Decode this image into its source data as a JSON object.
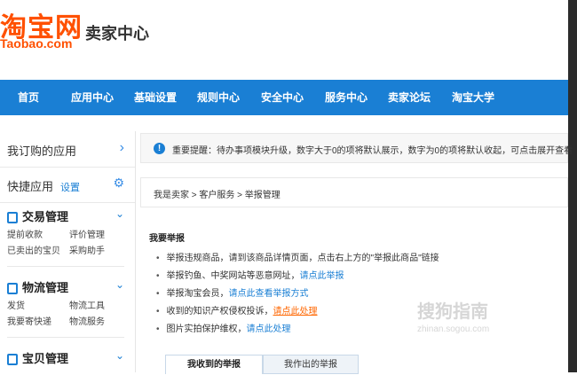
{
  "header": {
    "logo_cn": "淘宝网",
    "logo_en": "Taobao.com",
    "center_title": "卖家中心"
  },
  "nav": [
    "首页",
    "应用中心",
    "基础设置",
    "规则中心",
    "安全中心",
    "服务中心",
    "卖家论坛",
    "淘宝大学"
  ],
  "sidebar": {
    "my_apps": "我订购的应用",
    "quick_apps": "快捷应用",
    "quick_apps_setting": "设置",
    "groups": [
      {
        "title": "交易管理",
        "links": [
          "提前收款",
          "评价管理",
          "已卖出的宝贝",
          "采购助手"
        ]
      },
      {
        "title": "物流管理",
        "links": [
          "发货",
          "物流工具",
          "我要寄快递",
          "物流服务"
        ]
      },
      {
        "title": "宝贝管理",
        "links": []
      }
    ]
  },
  "notice": {
    "icon": "!",
    "text": "重要提醒：待办事项模块升级，数字大于0的项将默认展示，数字为0的项将默认收起，可点击展开查看"
  },
  "breadcrumb": "我是卖家 > 客户服务 > 举报管理",
  "content": {
    "title": "我要举报",
    "items": [
      {
        "text": "举报违规商品，请到该商品详情页面，点击右上方的\"举报此商品\"链接",
        "link": ""
      },
      {
        "text": "举报钓鱼、中奖网站等恶意网址，",
        "link": "请点此举报"
      },
      {
        "text": "举报淘宝会员，",
        "link": "请点此查看举报方式"
      },
      {
        "text": "收到的知识产权侵权投诉，",
        "link": "请点此处理"
      },
      {
        "text": "图片实拍保护维权，",
        "link": "请点此处理"
      }
    ]
  },
  "tabs": [
    "我收到的举报",
    "我作出的举报"
  ],
  "watermark": {
    "main": "搜狗指南",
    "sub": "zhinan.sogou.com"
  },
  "colors": {
    "brand_orange": "#ff5000",
    "nav_blue": "#1a7fd4",
    "link_blue": "#1a7fd4",
    "link_orange": "#ff6600"
  }
}
